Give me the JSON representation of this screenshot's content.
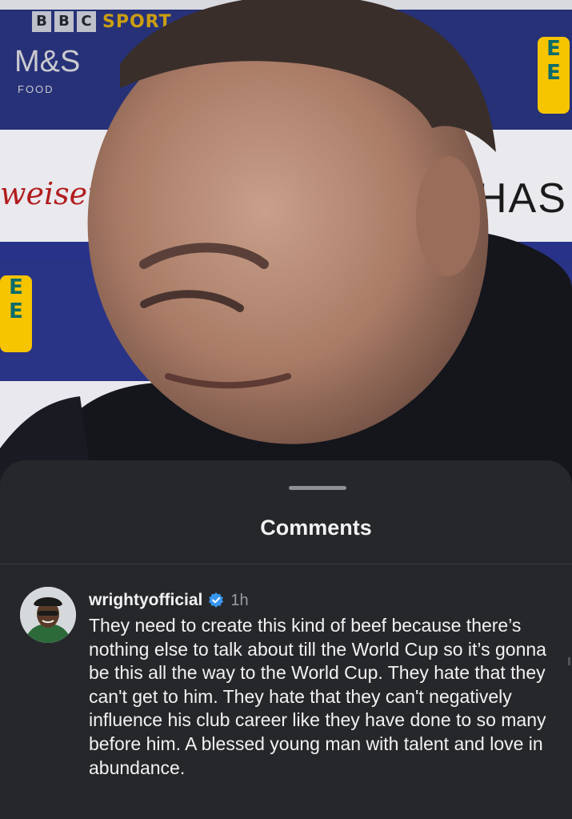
{
  "video": {
    "broadcaster_mark": [
      "B",
      "B",
      "C"
    ],
    "broadcaster_word": "SPORT",
    "sponsor_ms": "M&S",
    "sponsor_ms_sub": "FOOD",
    "sponsor_ee": "EE",
    "sponsor_budweiser": "weiser",
    "sponsor_has": "HAS"
  },
  "sheet": {
    "title": "Comments"
  },
  "comments": [
    {
      "username": "wrightyofficial",
      "verified": true,
      "time": "1h",
      "text": "They need to create this kind of beef because there’s nothing else to talk about till the World Cup so it’s gonna be this all the way to the World Cup. They hate that they can't get to him. They hate that they can't negatively influence his club career like they have done to so many before him. A blessed young man with talent and love in abundance."
    }
  ],
  "colors": {
    "sheet_bg": "#26272b",
    "verified_blue": "#3897f0",
    "text_primary": "#f2f2f2",
    "text_secondary": "#9a9ba0"
  }
}
